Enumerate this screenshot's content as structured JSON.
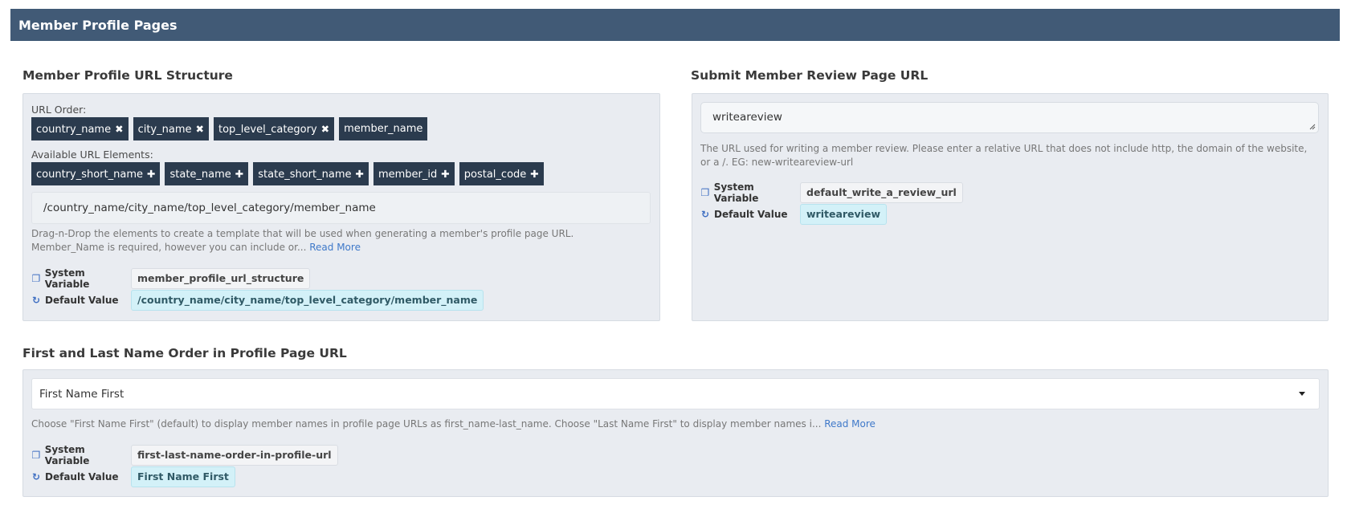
{
  "header": {
    "title": "Member Profile Pages"
  },
  "url_structure": {
    "title": "Member Profile URL Structure",
    "order_label": "URL Order:",
    "order": [
      {
        "label": "country_name",
        "icon": "remove-icon"
      },
      {
        "label": "city_name",
        "icon": "remove-icon"
      },
      {
        "label": "top_level_category",
        "icon": "remove-icon"
      },
      {
        "label": "member_name",
        "icon": ""
      }
    ],
    "available_label": "Available URL Elements:",
    "available": [
      {
        "label": "country_short_name",
        "icon": "add-icon"
      },
      {
        "label": "state_name",
        "icon": "add-icon"
      },
      {
        "label": "state_short_name",
        "icon": "add-icon"
      },
      {
        "label": "member_id",
        "icon": "add-icon"
      },
      {
        "label": "postal_code",
        "icon": "add-icon"
      }
    ],
    "preview": "/country_name/city_name/top_level_category/member_name",
    "help_text": "Drag-n-Drop the elements to create a template that will be used when generating a member's profile page URL. Member_Name is required, however you can include or...",
    "read_more": "Read More",
    "system_variable_label": "System Variable",
    "system_variable": "member_profile_url_structure",
    "default_value_label": "Default Value",
    "default_value": "/country_name/city_name/top_level_category/member_name"
  },
  "review_url": {
    "title": "Submit Member Review Page URL",
    "value": "writeareview",
    "help_text": "The URL used for writing a member review. Please enter a relative URL that does not include http, the domain of the website, or a /. EG: new-writeareview-url",
    "system_variable_label": "System Variable",
    "system_variable": "default_write_a_review_url",
    "default_value_label": "Default Value",
    "default_value": "writeareview"
  },
  "name_order": {
    "title": "First and Last Name Order in Profile Page URL",
    "selected": "First Name First",
    "help_text": "Choose \"First Name First\" (default) to display member names in profile page URLs as first_name-last_name. Choose \"Last Name First\" to display member names i...",
    "read_more": "Read More",
    "system_variable_label": "System Variable",
    "system_variable": "first-last-name-order-in-profile-url",
    "default_value_label": "Default Value",
    "default_value": "First Name First"
  }
}
